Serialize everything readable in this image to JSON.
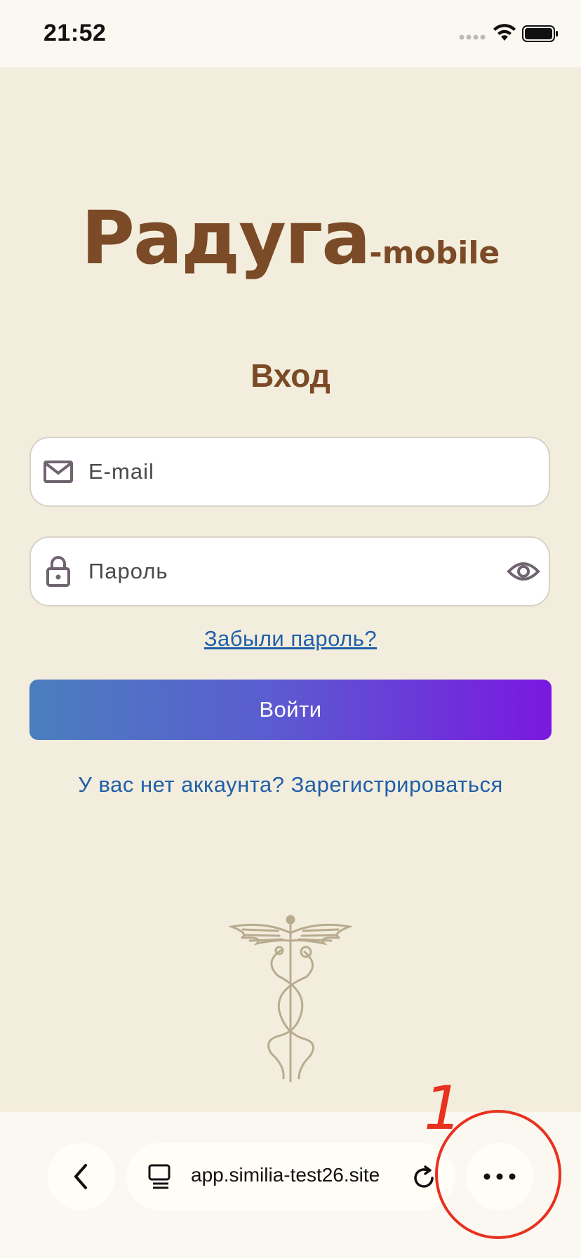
{
  "status_bar": {
    "time": "21:52"
  },
  "app": {
    "logo_main": "Радуга",
    "logo_sub": "-mobile"
  },
  "login": {
    "title": "Вход",
    "email_placeholder": "E-mail",
    "password_placeholder": "Пароль",
    "forgot_password": "Забыли пароль?",
    "submit_label": "Войти",
    "register_link": "У вас нет аккаунта? Зарегистрироваться"
  },
  "browser": {
    "url": "app.similia-test26.site"
  },
  "annotation": {
    "label": "1",
    "color": "#e8311f"
  },
  "colors": {
    "background": "#f3eddd",
    "brand_brown": "#7b4a26",
    "link_blue": "#1f5fa9",
    "button_gradient_start": "#4a7fbd",
    "button_gradient_end": "#7a18e0"
  }
}
